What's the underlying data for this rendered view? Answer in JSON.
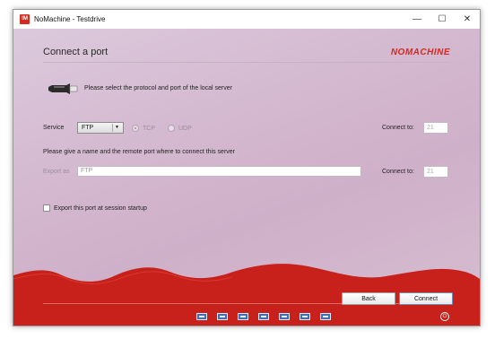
{
  "window": {
    "title": "NoMachine - Testdrive",
    "app_icon_text": "!M",
    "controls": {
      "minimize": "—",
      "maximize": "☐",
      "close": "✕"
    }
  },
  "header": {
    "title": "Connect a port",
    "brand": "NOMACHINE"
  },
  "intro_text": "Please select the protocol and port of the local server",
  "service": {
    "label": "Service",
    "selected": "FTP",
    "protocols": [
      {
        "label": "TCP",
        "selected": true
      },
      {
        "label": "UDP",
        "selected": false
      }
    ],
    "connect_to_label": "Connect to:",
    "connect_to_value": "21"
  },
  "remote": {
    "instruction": "Please give a name and the remote port where to connect this server",
    "export_as_label": "Export as",
    "export_as_value": "FTP",
    "connect_to_label": "Connect to:",
    "connect_to_value": "21"
  },
  "startup_checkbox": {
    "label": "Export this port at session startup",
    "checked": false
  },
  "buttons": {
    "back": "Back",
    "connect": "Connect"
  },
  "colors": {
    "brand": "#d42a20",
    "wave": "#c8201a",
    "background": "#d4b9d0"
  },
  "toolbar_icons": [
    "display-icon",
    "fit-screen-icon",
    "keyboard-icon",
    "resize-icon",
    "screen-sharing-icon",
    "monitor-icon",
    "monitor-settings-icon"
  ],
  "power_icon": "power-icon"
}
